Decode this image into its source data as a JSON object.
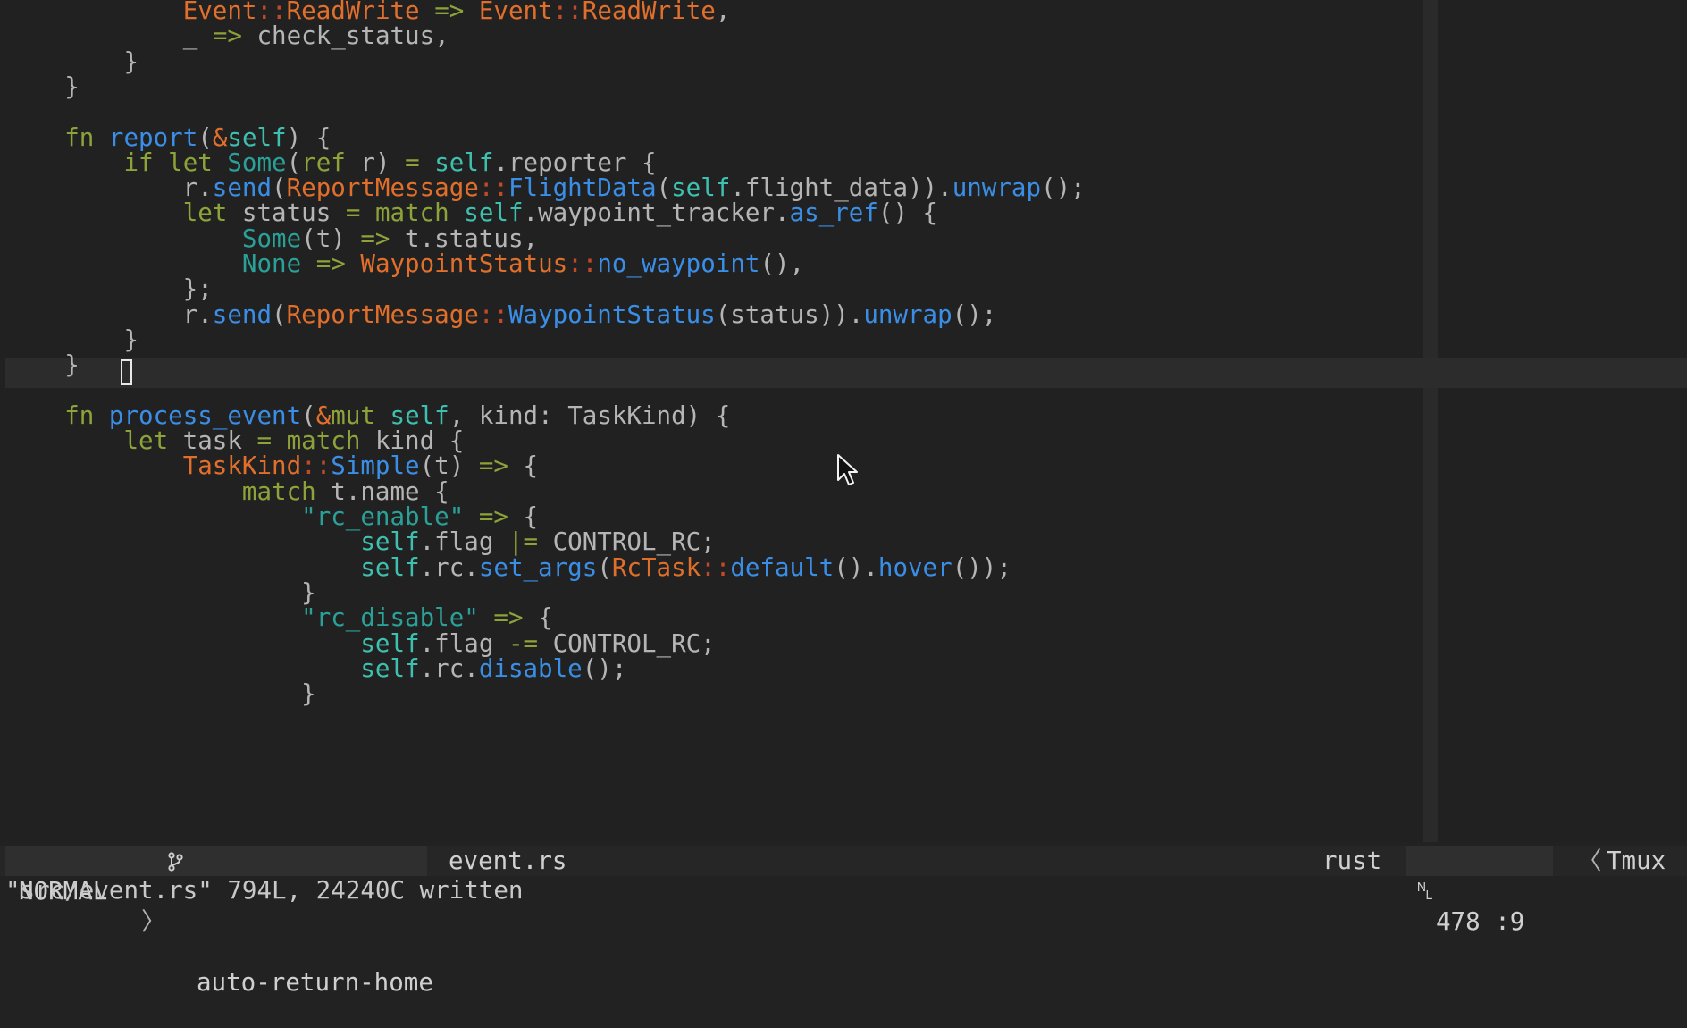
{
  "editor": {
    "lines": [
      [
        {
          "c": "n",
          "t": "            "
        },
        {
          "c": "t",
          "t": "Event"
        },
        {
          "c": "dc",
          "t": "::"
        },
        {
          "c": "t",
          "t": "ReadWrite"
        },
        {
          "c": "n",
          "t": " "
        },
        {
          "c": "op",
          "t": "=>"
        },
        {
          "c": "n",
          "t": " "
        },
        {
          "c": "t",
          "t": "Event"
        },
        {
          "c": "dc",
          "t": "::"
        },
        {
          "c": "t",
          "t": "ReadWrite"
        },
        {
          "c": "n",
          "t": ","
        }
      ],
      [
        {
          "c": "n",
          "t": "            "
        },
        {
          "c": "n",
          "t": "_ "
        },
        {
          "c": "op",
          "t": "=>"
        },
        {
          "c": "n",
          "t": " check_status,"
        }
      ],
      [
        {
          "c": "n",
          "t": "        }"
        }
      ],
      [
        {
          "c": "n",
          "t": "    }"
        }
      ],
      [],
      [
        {
          "c": "n",
          "t": "    "
        },
        {
          "c": "k",
          "t": "fn"
        },
        {
          "c": "n",
          "t": " "
        },
        {
          "c": "f",
          "t": "report"
        },
        {
          "c": "n",
          "t": "("
        },
        {
          "c": "t",
          "t": "&"
        },
        {
          "c": "sl",
          "t": "self"
        },
        {
          "c": "n",
          "t": ") {"
        }
      ],
      [
        {
          "c": "n",
          "t": "        "
        },
        {
          "c": "k",
          "t": "if"
        },
        {
          "c": "n",
          "t": " "
        },
        {
          "c": "k",
          "t": "let"
        },
        {
          "c": "n",
          "t": " "
        },
        {
          "c": "s",
          "t": "Some"
        },
        {
          "c": "n",
          "t": "("
        },
        {
          "c": "k",
          "t": "ref"
        },
        {
          "c": "n",
          "t": " r) "
        },
        {
          "c": "op",
          "t": "="
        },
        {
          "c": "n",
          "t": " "
        },
        {
          "c": "sl",
          "t": "self"
        },
        {
          "c": "n",
          "t": ".reporter {"
        }
      ],
      [
        {
          "c": "n",
          "t": "            r."
        },
        {
          "c": "f",
          "t": "send"
        },
        {
          "c": "n",
          "t": "("
        },
        {
          "c": "t",
          "t": "ReportMessage"
        },
        {
          "c": "dc",
          "t": "::"
        },
        {
          "c": "f",
          "t": "FlightData"
        },
        {
          "c": "n",
          "t": "("
        },
        {
          "c": "sl",
          "t": "self"
        },
        {
          "c": "n",
          "t": ".flight_data))."
        },
        {
          "c": "f",
          "t": "unwrap"
        },
        {
          "c": "n",
          "t": "();"
        }
      ],
      [
        {
          "c": "n",
          "t": "            "
        },
        {
          "c": "k",
          "t": "let"
        },
        {
          "c": "n",
          "t": " status "
        },
        {
          "c": "op",
          "t": "="
        },
        {
          "c": "n",
          "t": " "
        },
        {
          "c": "k",
          "t": "match"
        },
        {
          "c": "n",
          "t": " "
        },
        {
          "c": "sl",
          "t": "self"
        },
        {
          "c": "n",
          "t": ".waypoint_tracker."
        },
        {
          "c": "f",
          "t": "as_ref"
        },
        {
          "c": "n",
          "t": "() {"
        }
      ],
      [
        {
          "c": "n",
          "t": "                "
        },
        {
          "c": "s",
          "t": "Some"
        },
        {
          "c": "n",
          "t": "(t) "
        },
        {
          "c": "op",
          "t": "=>"
        },
        {
          "c": "n",
          "t": " t.status,"
        }
      ],
      [
        {
          "c": "n",
          "t": "                "
        },
        {
          "c": "s",
          "t": "None"
        },
        {
          "c": "n",
          "t": " "
        },
        {
          "c": "op",
          "t": "=>"
        },
        {
          "c": "n",
          "t": " "
        },
        {
          "c": "t",
          "t": "WaypointStatus"
        },
        {
          "c": "dc",
          "t": "::"
        },
        {
          "c": "f",
          "t": "no_waypoint"
        },
        {
          "c": "n",
          "t": "(),"
        }
      ],
      [
        {
          "c": "n",
          "t": "            };"
        }
      ],
      [
        {
          "c": "n",
          "t": "            r."
        },
        {
          "c": "f",
          "t": "send"
        },
        {
          "c": "n",
          "t": "("
        },
        {
          "c": "t",
          "t": "ReportMessage"
        },
        {
          "c": "dc",
          "t": "::"
        },
        {
          "c": "f",
          "t": "WaypointStatus"
        },
        {
          "c": "n",
          "t": "(status))."
        },
        {
          "c": "f",
          "t": "unwrap"
        },
        {
          "c": "n",
          "t": "();"
        }
      ],
      [
        {
          "c": "n",
          "t": "        }"
        }
      ],
      [
        {
          "c": "n",
          "t": "    }"
        }
      ],
      [],
      [
        {
          "c": "n",
          "t": "    "
        },
        {
          "c": "k",
          "t": "fn"
        },
        {
          "c": "n",
          "t": " "
        },
        {
          "c": "f",
          "t": "process_event"
        },
        {
          "c": "n",
          "t": "("
        },
        {
          "c": "t",
          "t": "&"
        },
        {
          "c": "k",
          "t": "mut"
        },
        {
          "c": "n",
          "t": " "
        },
        {
          "c": "sl",
          "t": "self"
        },
        {
          "c": "n",
          "t": ", kind: TaskKind) {"
        }
      ],
      [
        {
          "c": "n",
          "t": "        "
        },
        {
          "c": "k",
          "t": "let"
        },
        {
          "c": "n",
          "t": " task "
        },
        {
          "c": "op",
          "t": "="
        },
        {
          "c": "n",
          "t": " "
        },
        {
          "c": "k",
          "t": "match"
        },
        {
          "c": "n",
          "t": " kind {"
        }
      ],
      [
        {
          "c": "n",
          "t": "            "
        },
        {
          "c": "t",
          "t": "TaskKind"
        },
        {
          "c": "dc",
          "t": "::"
        },
        {
          "c": "f",
          "t": "Simple"
        },
        {
          "c": "n",
          "t": "(t) "
        },
        {
          "c": "op",
          "t": "=>"
        },
        {
          "c": "n",
          "t": " {"
        }
      ],
      [
        {
          "c": "n",
          "t": "                "
        },
        {
          "c": "k",
          "t": "match"
        },
        {
          "c": "n",
          "t": " t.name {"
        }
      ],
      [
        {
          "c": "n",
          "t": "                    "
        },
        {
          "c": "s",
          "t": "\"rc_enable\""
        },
        {
          "c": "n",
          "t": " "
        },
        {
          "c": "op",
          "t": "=>"
        },
        {
          "c": "n",
          "t": " {"
        }
      ],
      [
        {
          "c": "n",
          "t": "                        "
        },
        {
          "c": "sl",
          "t": "self"
        },
        {
          "c": "n",
          "t": ".flag "
        },
        {
          "c": "op",
          "t": "|="
        },
        {
          "c": "n",
          "t": " CONTROL_RC;"
        }
      ],
      [
        {
          "c": "n",
          "t": "                        "
        },
        {
          "c": "sl",
          "t": "self"
        },
        {
          "c": "n",
          "t": ".rc."
        },
        {
          "c": "f",
          "t": "set_args"
        },
        {
          "c": "n",
          "t": "("
        },
        {
          "c": "t",
          "t": "RcTask"
        },
        {
          "c": "dc",
          "t": "::"
        },
        {
          "c": "f",
          "t": "default"
        },
        {
          "c": "n",
          "t": "()."
        },
        {
          "c": "f",
          "t": "hover"
        },
        {
          "c": "n",
          "t": "());"
        }
      ],
      [
        {
          "c": "n",
          "t": "                    }"
        }
      ],
      [
        {
          "c": "n",
          "t": "                    "
        },
        {
          "c": "s",
          "t": "\"rc_disable\""
        },
        {
          "c": "n",
          "t": " "
        },
        {
          "c": "op",
          "t": "=>"
        },
        {
          "c": "n",
          "t": " {"
        }
      ],
      [
        {
          "c": "n",
          "t": "                        "
        },
        {
          "c": "sl",
          "t": "self"
        },
        {
          "c": "n",
          "t": ".flag "
        },
        {
          "c": "op",
          "t": "-="
        },
        {
          "c": "n",
          "t": " CONTROL_RC;"
        }
      ],
      [
        {
          "c": "n",
          "t": "                        "
        },
        {
          "c": "sl",
          "t": "self"
        },
        {
          "c": "n",
          "t": ".rc."
        },
        {
          "c": "f",
          "t": "disable"
        },
        {
          "c": "n",
          "t": "();"
        }
      ],
      [
        {
          "c": "n",
          "t": "                    }"
        }
      ]
    ]
  },
  "statusline": {
    "mode": "NORMAL",
    "mode_separator": "〉",
    "branch_icon": "git-branch-icon",
    "branch": "auto-return-home",
    "file": "event.rs",
    "filetype": "rust",
    "line_icon": "line-number-icon",
    "line_glyph": "␤",
    "position": "478 :9",
    "right_separator": "〈",
    "session": "Tmux"
  },
  "cmdline": {
    "message": "\"src/event.rs\" 794L, 24240C written"
  }
}
